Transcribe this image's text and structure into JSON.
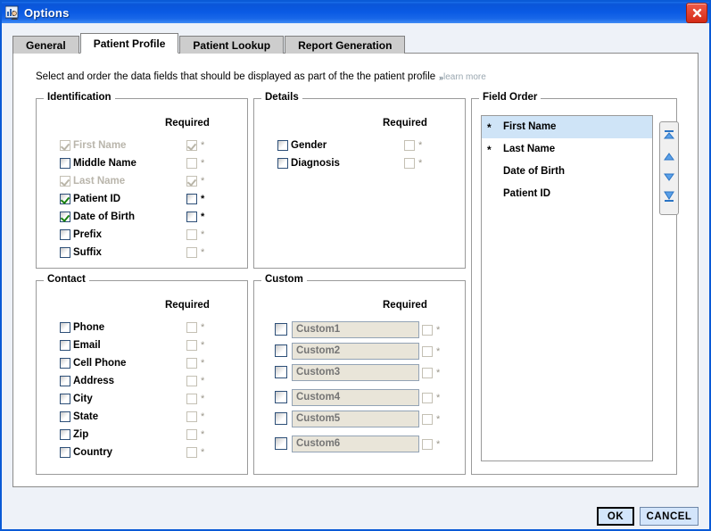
{
  "window": {
    "title": "Options",
    "icon": "chart-person-icon",
    "close_label": "Close",
    "accent_color": "#0a5ad6",
    "body_color": "#eef2f8"
  },
  "tabs": [
    {
      "label": "General",
      "active": false
    },
    {
      "label": "Patient Profile",
      "active": true
    },
    {
      "label": "Patient Lookup",
      "active": false
    },
    {
      "label": "Report Generation",
      "active": false
    }
  ],
  "page": {
    "description": "Select and order the data fields that should be displayed as part of the the patient profile",
    "learn_more": "learn more",
    "learn_more_chevrons": "»"
  },
  "required_header": "Required",
  "groups": {
    "identification": {
      "legend": "Identification",
      "rows": [
        {
          "label": "First Name",
          "checked": true,
          "enabled": false,
          "req_checked": true,
          "req_enabled": false
        },
        {
          "label": "Middle Name",
          "checked": false,
          "enabled": true,
          "req_checked": false,
          "req_enabled": false
        },
        {
          "label": "Last Name",
          "checked": true,
          "enabled": false,
          "req_checked": true,
          "req_enabled": false
        },
        {
          "label": "Patient ID",
          "checked": true,
          "enabled": true,
          "req_checked": false,
          "req_enabled": true
        },
        {
          "label": "Date of Birth",
          "checked": true,
          "enabled": true,
          "req_checked": false,
          "req_enabled": true
        },
        {
          "label": "Prefix",
          "checked": false,
          "enabled": true,
          "req_checked": false,
          "req_enabled": false
        },
        {
          "label": "Suffix",
          "checked": false,
          "enabled": true,
          "req_checked": false,
          "req_enabled": false
        }
      ]
    },
    "contact": {
      "legend": "Contact",
      "rows": [
        {
          "label": "Phone",
          "checked": false,
          "enabled": true,
          "req_checked": false,
          "req_enabled": false
        },
        {
          "label": "Email",
          "checked": false,
          "enabled": true,
          "req_checked": false,
          "req_enabled": false
        },
        {
          "label": "Cell Phone",
          "checked": false,
          "enabled": true,
          "req_checked": false,
          "req_enabled": false
        },
        {
          "label": "Address",
          "checked": false,
          "enabled": true,
          "req_checked": false,
          "req_enabled": false
        },
        {
          "label": "City",
          "checked": false,
          "enabled": true,
          "req_checked": false,
          "req_enabled": false
        },
        {
          "label": "State",
          "checked": false,
          "enabled": true,
          "req_checked": false,
          "req_enabled": false
        },
        {
          "label": "Zip",
          "checked": false,
          "enabled": true,
          "req_checked": false,
          "req_enabled": false
        },
        {
          "label": "Country",
          "checked": false,
          "enabled": true,
          "req_checked": false,
          "req_enabled": false
        }
      ]
    },
    "details": {
      "legend": "Details",
      "rows": [
        {
          "label": "Gender",
          "checked": false,
          "enabled": true,
          "req_checked": false,
          "req_enabled": false
        },
        {
          "label": "Diagnosis",
          "checked": false,
          "enabled": true,
          "req_checked": false,
          "req_enabled": false
        }
      ]
    },
    "custom": {
      "legend": "Custom",
      "rows": [
        {
          "placeholder": "Custom1",
          "value": "",
          "checked": false,
          "req_checked": false
        },
        {
          "placeholder": "Custom2",
          "value": "",
          "checked": false,
          "req_checked": false
        },
        {
          "placeholder": "Custom3",
          "value": "",
          "checked": false,
          "req_checked": false
        },
        {
          "placeholder": "Custom4",
          "value": "",
          "checked": false,
          "req_checked": false
        },
        {
          "placeholder": "Custom5",
          "value": "",
          "checked": false,
          "req_checked": false
        },
        {
          "placeholder": "Custom6",
          "value": "",
          "checked": false,
          "req_checked": false
        }
      ]
    },
    "field_order": {
      "legend": "Field Order",
      "items": [
        {
          "marker": "*",
          "label": "First Name",
          "selected": true
        },
        {
          "marker": "*",
          "label": "Last Name",
          "selected": false
        },
        {
          "marker": "",
          "label": "Date of Birth",
          "selected": false
        },
        {
          "marker": "",
          "label": "Patient ID",
          "selected": false
        }
      ],
      "buttons": [
        {
          "name": "move-to-top-icon",
          "title": "Move to top"
        },
        {
          "name": "move-up-icon",
          "title": "Move up"
        },
        {
          "name": "move-down-icon",
          "title": "Move down"
        },
        {
          "name": "move-to-bottom-icon",
          "title": "Move to bottom"
        }
      ]
    }
  },
  "footer": {
    "ok": "OK",
    "cancel": "CANCEL"
  }
}
